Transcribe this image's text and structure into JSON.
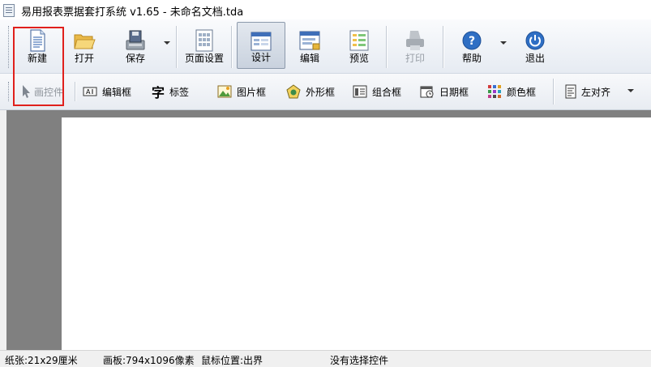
{
  "window": {
    "title": "易用报表票据套打系统 v1.65 - 未命名文档.tda"
  },
  "toolbar": {
    "new_label": "新建",
    "open_label": "打开",
    "save_label": "保存",
    "page_setup_label": "页面设置",
    "design_label": "设计",
    "edit_label": "编辑",
    "preview_label": "预览",
    "print_label": "打印",
    "help_label": "帮助",
    "exit_label": "退出"
  },
  "controls": {
    "pointer_label": "画控件",
    "editbox_label": "编辑框",
    "label_label": "标签",
    "label_glyph": "字",
    "picture_label": "图片框",
    "shape_label": "外形框",
    "group_label": "组合框",
    "date_label": "日期框",
    "color_label": "颜色框",
    "align_label": "左对齐"
  },
  "status": {
    "paper": "纸张:21x29厘米",
    "canvas": "画板:794x1096像素",
    "mouse": "鼠标位置:出界",
    "selection": "没有选择控件"
  },
  "colors": {
    "highlight": "#e0201c",
    "accent": "#2f6fc4"
  }
}
